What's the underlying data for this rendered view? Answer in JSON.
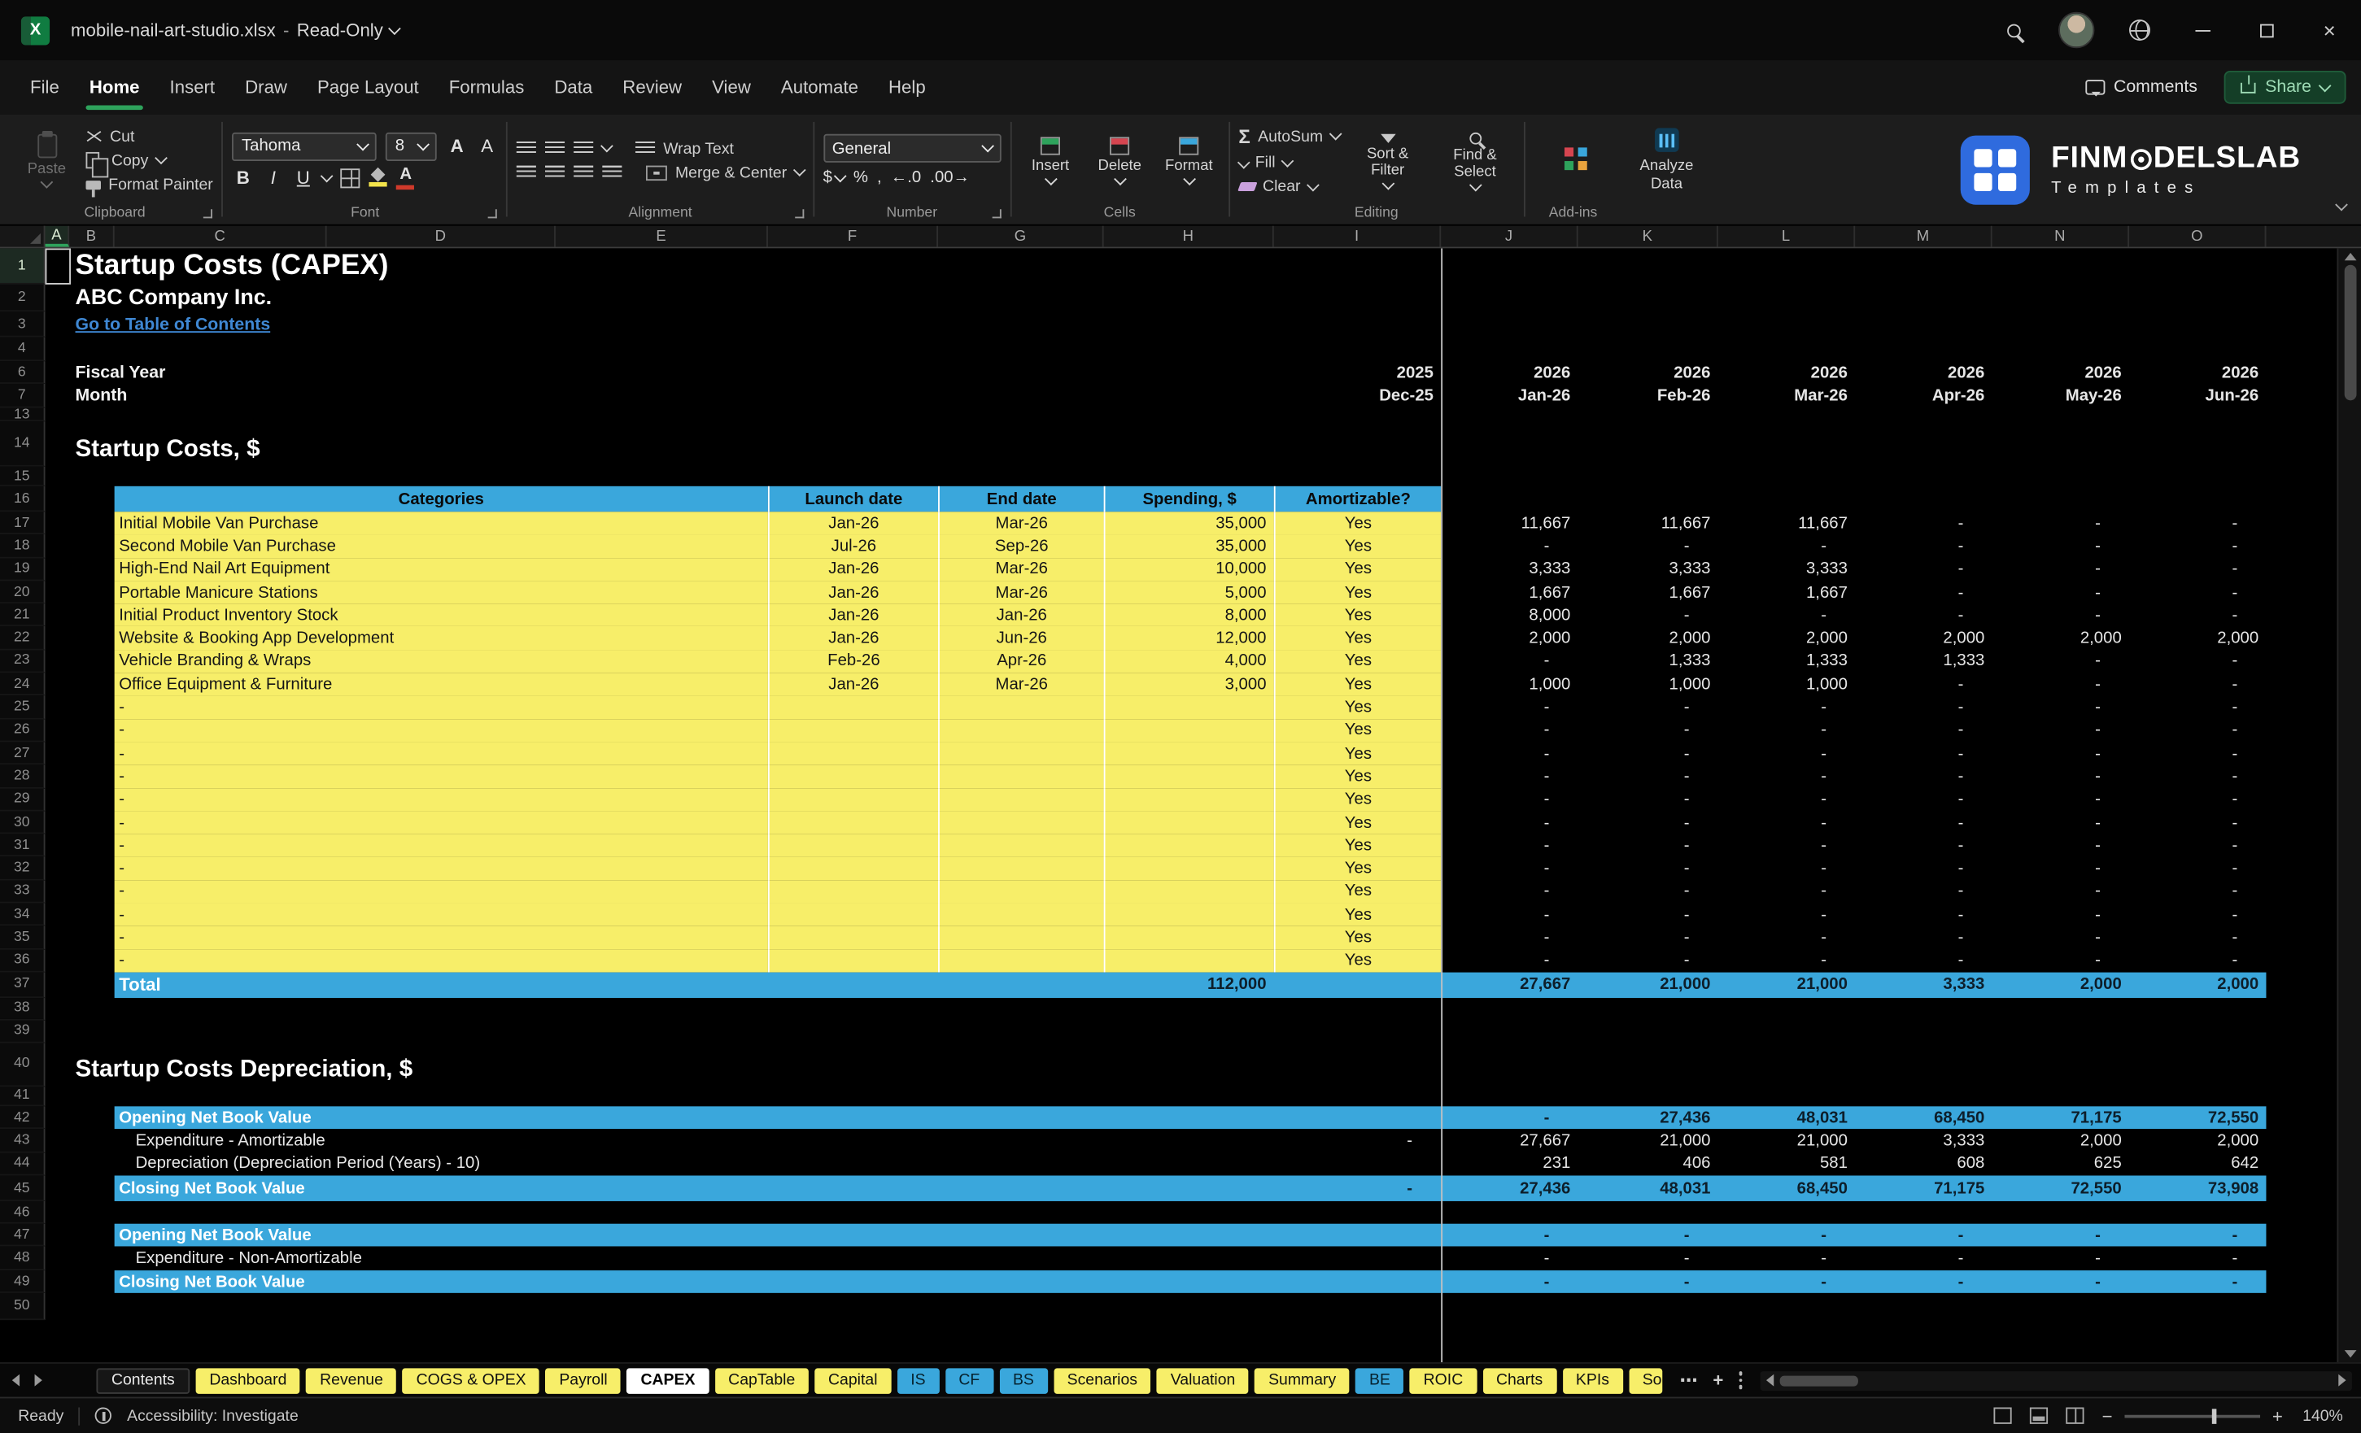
{
  "titlebar": {
    "file": "mobile-nail-art-studio.xlsx",
    "sep": "-",
    "mode": "Read-Only"
  },
  "menubar": {
    "items": [
      "File",
      "Home",
      "Insert",
      "Draw",
      "Page Layout",
      "Formulas",
      "Data",
      "Review",
      "View",
      "Automate",
      "Help"
    ],
    "active": "Home",
    "comments": "Comments",
    "share": "Share"
  },
  "ribbon": {
    "clipboard": {
      "label": "Clipboard",
      "paste": "Paste",
      "cut": "Cut",
      "copy": "Copy",
      "painter": "Format Painter"
    },
    "font": {
      "label": "Font",
      "name": "Tahoma",
      "size": "8"
    },
    "alignment": {
      "label": "Alignment",
      "wrap": "Wrap Text",
      "merge": "Merge & Center"
    },
    "number": {
      "label": "Number",
      "format": "General"
    },
    "cells": {
      "label": "Cells",
      "insert": "Insert",
      "delete": "Delete",
      "format": "Format"
    },
    "editing": {
      "label": "Editing",
      "autosum": "AutoSum",
      "fill": "Fill",
      "clear": "Clear",
      "sort": "Sort & Filter",
      "find": "Find & Select"
    },
    "addins": {
      "label": "Add-ins",
      "analyze": "Analyze Data"
    },
    "logo": {
      "pre": "FINM",
      "post": "DELSLAB",
      "sub": "Templates"
    }
  },
  "icons": {
    "x": "X",
    "bold": "B",
    "italic": "I",
    "underline": "U",
    "a": "A",
    "dollar": "$",
    "percent": "%",
    "comma": ",",
    "autosum": "Σ",
    "decinc": "←.0",
    "decdec": ".00→",
    "close": "×",
    "more": "⋯",
    "plus": "+",
    "minus": "−",
    "zoomplus": "+"
  },
  "grid": {
    "columns": [
      {
        "id": "A",
        "w": 16
      },
      {
        "id": "B",
        "w": 30
      },
      {
        "id": "C",
        "w": 141
      },
      {
        "id": "D",
        "w": 152
      },
      {
        "id": "E",
        "w": 141
      },
      {
        "id": "F",
        "w": 113
      },
      {
        "id": "G",
        "w": 110
      },
      {
        "id": "H",
        "w": 113
      },
      {
        "id": "I",
        "w": 111
      },
      {
        "id": "J",
        "w": 91
      },
      {
        "id": "K",
        "w": 93
      },
      {
        "id": "L",
        "w": 91
      },
      {
        "id": "M",
        "w": 91
      },
      {
        "id": "N",
        "w": 91
      },
      {
        "id": "O",
        "w": 91
      }
    ],
    "table_widths": [
      434,
      113,
      110,
      113,
      111
    ],
    "month_widths": [
      91,
      93,
      91,
      91,
      91,
      91
    ],
    "selected_col": "A",
    "selected_row": 1
  },
  "sheet": {
    "rows": [
      {
        "n": 1,
        "t": "title",
        "h": 24,
        "text": "Startup Costs (CAPEX)"
      },
      {
        "n": 2,
        "t": "subtitle",
        "h": 18,
        "text": "ABC Company Inc."
      },
      {
        "n": 3,
        "t": "link",
        "h": 17,
        "text": "Go to Table of Contents"
      },
      {
        "n": 4,
        "t": "empty",
        "h": 16
      },
      {
        "n": 6,
        "t": "fiscal",
        "h": 15,
        "label": "Fiscal Year",
        "i": "2025",
        "m": [
          "2026",
          "2026",
          "2026",
          "2026",
          "2026",
          "2026"
        ]
      },
      {
        "n": 7,
        "t": "fiscal",
        "h": 16,
        "label": "Month",
        "i": "Dec-25",
        "m": [
          "Jan-26",
          "Feb-26",
          "Mar-26",
          "Apr-26",
          "May-26",
          "Jun-26"
        ]
      },
      {
        "n": 13,
        "t": "empty",
        "h": 9
      },
      {
        "n": 14,
        "t": "section",
        "h": 30,
        "text": "Startup Costs, $"
      },
      {
        "n": 15,
        "t": "empty",
        "h": 13
      },
      {
        "n": 16,
        "t": "thead",
        "h": 17,
        "cells": [
          "Categories",
          "Launch date",
          "End date",
          "Spending, $",
          "Amortizable?"
        ]
      },
      {
        "n": 17,
        "t": "item",
        "h": 15.3,
        "c": "Initial Mobile Van Purchase",
        "f": "Jan-26",
        "g": "Mar-26",
        "s": "35,000",
        "a": "Yes",
        "m": [
          "11,667",
          "11,667",
          "11,667",
          "-",
          "-",
          "-"
        ]
      },
      {
        "n": 18,
        "t": "item",
        "h": 15.3,
        "c": "Second Mobile Van Purchase",
        "f": "Jul-26",
        "g": "Sep-26",
        "s": "35,000",
        "a": "Yes",
        "m": [
          "-",
          "-",
          "-",
          "-",
          "-",
          "-"
        ]
      },
      {
        "n": 19,
        "t": "item",
        "h": 15.3,
        "c": "High-End Nail Art Equipment",
        "f": "Jan-26",
        "g": "Mar-26",
        "s": "10,000",
        "a": "Yes",
        "m": [
          "3,333",
          "3,333",
          "3,333",
          "-",
          "-",
          "-"
        ]
      },
      {
        "n": 20,
        "t": "item",
        "h": 15.3,
        "c": "Portable Manicure Stations",
        "f": "Jan-26",
        "g": "Mar-26",
        "s": "5,000",
        "a": "Yes",
        "m": [
          "1,667",
          "1,667",
          "1,667",
          "-",
          "-",
          "-"
        ]
      },
      {
        "n": 21,
        "t": "item",
        "h": 15.3,
        "c": "Initial Product Inventory Stock",
        "f": "Jan-26",
        "g": "Jan-26",
        "s": "8,000",
        "a": "Yes",
        "m": [
          "8,000",
          "-",
          "-",
          "-",
          "-",
          "-"
        ]
      },
      {
        "n": 22,
        "t": "item",
        "h": 15.3,
        "c": "Website & Booking App Development",
        "f": "Jan-26",
        "g": "Jun-26",
        "s": "12,000",
        "a": "Yes",
        "m": [
          "2,000",
          "2,000",
          "2,000",
          "2,000",
          "2,000",
          "2,000"
        ]
      },
      {
        "n": 23,
        "t": "item",
        "h": 15.3,
        "c": "Vehicle Branding & Wraps",
        "f": "Feb-26",
        "g": "Apr-26",
        "s": "4,000",
        "a": "Yes",
        "m": [
          "-",
          "1,333",
          "1,333",
          "1,333",
          "-",
          "-"
        ]
      },
      {
        "n": 24,
        "t": "item",
        "h": 15.3,
        "c": "Office Equipment & Furniture",
        "f": "Jan-26",
        "g": "Mar-26",
        "s": "3,000",
        "a": "Yes",
        "m": [
          "1,000",
          "1,000",
          "1,000",
          "-",
          "-",
          "-"
        ]
      },
      {
        "n": 25,
        "t": "item",
        "h": 15.3,
        "c": "-",
        "f": "",
        "g": "",
        "s": "",
        "a": "Yes",
        "m": [
          "-",
          "-",
          "-",
          "-",
          "-",
          "-"
        ]
      },
      {
        "n": 26,
        "t": "item",
        "h": 15.3,
        "c": "-",
        "f": "",
        "g": "",
        "s": "",
        "a": "Yes",
        "m": [
          "-",
          "-",
          "-",
          "-",
          "-",
          "-"
        ]
      },
      {
        "n": 27,
        "t": "item",
        "h": 15.3,
        "c": "-",
        "f": "",
        "g": "",
        "s": "",
        "a": "Yes",
        "m": [
          "-",
          "-",
          "-",
          "-",
          "-",
          "-"
        ]
      },
      {
        "n": 28,
        "t": "item",
        "h": 15.3,
        "c": "-",
        "f": "",
        "g": "",
        "s": "",
        "a": "Yes",
        "m": [
          "-",
          "-",
          "-",
          "-",
          "-",
          "-"
        ]
      },
      {
        "n": 29,
        "t": "item",
        "h": 15.3,
        "c": "-",
        "f": "",
        "g": "",
        "s": "",
        "a": "Yes",
        "m": [
          "-",
          "-",
          "-",
          "-",
          "-",
          "-"
        ]
      },
      {
        "n": 30,
        "t": "item",
        "h": 15.3,
        "c": "-",
        "f": "",
        "g": "",
        "s": "",
        "a": "Yes",
        "m": [
          "-",
          "-",
          "-",
          "-",
          "-",
          "-"
        ]
      },
      {
        "n": 31,
        "t": "item",
        "h": 15.3,
        "c": "-",
        "f": "",
        "g": "",
        "s": "",
        "a": "Yes",
        "m": [
          "-",
          "-",
          "-",
          "-",
          "-",
          "-"
        ]
      },
      {
        "n": 32,
        "t": "item",
        "h": 15.3,
        "c": "-",
        "f": "",
        "g": "",
        "s": "",
        "a": "Yes",
        "m": [
          "-",
          "-",
          "-",
          "-",
          "-",
          "-"
        ]
      },
      {
        "n": 33,
        "t": "item",
        "h": 15.3,
        "c": "-",
        "f": "",
        "g": "",
        "s": "",
        "a": "Yes",
        "m": [
          "-",
          "-",
          "-",
          "-",
          "-",
          "-"
        ]
      },
      {
        "n": 34,
        "t": "item",
        "h": 15.3,
        "c": "-",
        "f": "",
        "g": "",
        "s": "",
        "a": "Yes",
        "m": [
          "-",
          "-",
          "-",
          "-",
          "-",
          "-"
        ]
      },
      {
        "n": 35,
        "t": "item",
        "h": 15.3,
        "c": "-",
        "f": "",
        "g": "",
        "s": "",
        "a": "Yes",
        "m": [
          "-",
          "-",
          "-",
          "-",
          "-",
          "-"
        ]
      },
      {
        "n": 36,
        "t": "item",
        "h": 15.3,
        "c": "-",
        "f": "",
        "g": "",
        "s": "",
        "a": "Yes",
        "m": [
          "-",
          "-",
          "-",
          "-",
          "-",
          "-"
        ]
      },
      {
        "n": 37,
        "t": "total",
        "h": 17,
        "label": "Total",
        "s": "112,000",
        "m": [
          "27,667",
          "21,000",
          "21,000",
          "3,333",
          "2,000",
          "2,000"
        ]
      },
      {
        "n": 38,
        "t": "empty",
        "h": 15
      },
      {
        "n": 39,
        "t": "empty",
        "h": 15
      },
      {
        "n": 40,
        "t": "section",
        "h": 29,
        "text": "Startup Costs Depreciation, $"
      },
      {
        "n": 41,
        "t": "empty",
        "h": 13
      },
      {
        "n": 42,
        "t": "blue",
        "h": 15.3,
        "label": "Opening Net Book Value",
        "i": "",
        "m": [
          "-",
          "27,436",
          "48,031",
          "68,450",
          "71,175",
          "72,550"
        ]
      },
      {
        "n": 43,
        "t": "plain",
        "h": 15.3,
        "ind": true,
        "label": "Expenditure - Amortizable",
        "i": "-",
        "m": [
          "27,667",
          "21,000",
          "21,000",
          "3,333",
          "2,000",
          "2,000"
        ]
      },
      {
        "n": 44,
        "t": "plain",
        "h": 15.6,
        "ind": true,
        "label": "Depreciation (Depreciation Period (Years) - 10)",
        "i": "",
        "m": [
          "231",
          "406",
          "581",
          "608",
          "625",
          "642"
        ]
      },
      {
        "n": 45,
        "t": "blue",
        "h": 17,
        "label": "Closing Net Book Value",
        "i": "-",
        "m": [
          "27,436",
          "48,031",
          "68,450",
          "71,175",
          "72,550",
          "73,908"
        ]
      },
      {
        "n": 46,
        "t": "empty",
        "h": 15
      },
      {
        "n": 47,
        "t": "blue",
        "h": 15.3,
        "label": "Opening Net Book Value",
        "i": "",
        "m": [
          "-",
          "-",
          "-",
          "-",
          "-",
          "-"
        ]
      },
      {
        "n": 48,
        "t": "plain",
        "h": 15.3,
        "ind": true,
        "label": "Expenditure - Non-Amortizable",
        "i": "",
        "m": [
          "-",
          "-",
          "-",
          "-",
          "-",
          "-"
        ]
      },
      {
        "n": 49,
        "t": "blue",
        "h": 15.6,
        "label": "Closing Net Book Value",
        "i": "",
        "m": [
          "-",
          "-",
          "-",
          "-",
          "-",
          "-"
        ]
      },
      {
        "n": 50,
        "t": "empty",
        "h": 18
      }
    ]
  },
  "tabs": {
    "items": [
      {
        "label": "Contents",
        "c": "dark"
      },
      {
        "label": "Dashboard",
        "c": "yellow"
      },
      {
        "label": "Revenue",
        "c": "yellow"
      },
      {
        "label": "COGS & OPEX",
        "c": "yellow"
      },
      {
        "label": "Payroll",
        "c": "yellow"
      },
      {
        "label": "CAPEX",
        "c": "active"
      },
      {
        "label": "CapTable",
        "c": "yellow"
      },
      {
        "label": "Capital",
        "c": "yellow"
      },
      {
        "label": "IS",
        "c": "blue"
      },
      {
        "label": "CF",
        "c": "blue"
      },
      {
        "label": "BS",
        "c": "blue"
      },
      {
        "label": "Scenarios",
        "c": "yellow"
      },
      {
        "label": "Valuation",
        "c": "yellow"
      },
      {
        "label": "Summary",
        "c": "yellow"
      },
      {
        "label": "BE",
        "c": "blue"
      },
      {
        "label": "ROIC",
        "c": "yellow"
      },
      {
        "label": "Charts",
        "c": "yellow"
      },
      {
        "label": "KPIs",
        "c": "yellow"
      },
      {
        "label": "So",
        "c": "yellow",
        "clip": true
      }
    ]
  },
  "statusbar": {
    "ready": "Ready",
    "accessibility": "Accessibility: Investigate",
    "zoom": "140%"
  }
}
